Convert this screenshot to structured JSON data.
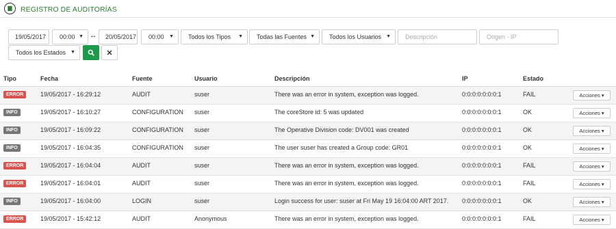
{
  "header": {
    "title": "REGISTRO DE AUDITORÍAS",
    "icon": "book-icon"
  },
  "filters": {
    "date_from": "19/05/2017",
    "time_from": "00:00",
    "date_to": "20/05/2017",
    "time_to": "00:00",
    "separator": "↔",
    "tipo": "Todos los Tipos",
    "fuente": "Todas las Fuentes",
    "usuario": "Todos los Usuarios",
    "descripcion_placeholder": "Descripción",
    "ip_placeholder": "Origen - IP",
    "estado": "Todos los Estados"
  },
  "columns": [
    "Tipo",
    "Fecha",
    "Fuente",
    "Usuario",
    "Descripción",
    "IP",
    "Estado"
  ],
  "action_label": "Acciones",
  "rows": [
    {
      "tipo": "ERROR",
      "fecha": "19/05/2017 - 16:29:12",
      "fuente": "AUDIT",
      "usuario": "suser",
      "descripcion": "There was an error in system, exception was logged.",
      "ip": "0:0:0:0:0:0:0:1",
      "estado": "FAIL"
    },
    {
      "tipo": "INFO",
      "fecha": "19/05/2017 - 16:10:27",
      "fuente": "CONFIGURATION",
      "usuario": "suser",
      "descripcion": "The coreStore id: 5 was updated",
      "ip": "0:0:0:0:0:0:0:1",
      "estado": "OK"
    },
    {
      "tipo": "INFO",
      "fecha": "19/05/2017 - 16:09:22",
      "fuente": "CONFIGURATION",
      "usuario": "suser",
      "descripcion": "The Operative Division code: DV001 was created",
      "ip": "0:0:0:0:0:0:0:1",
      "estado": "OK"
    },
    {
      "tipo": "INFO",
      "fecha": "19/05/2017 - 16:04:35",
      "fuente": "CONFIGURATION",
      "usuario": "suser",
      "descripcion": "The user suser has created a Group code: GR01",
      "ip": "0:0:0:0:0:0:0:1",
      "estado": "OK"
    },
    {
      "tipo": "ERROR",
      "fecha": "19/05/2017 - 16:04:04",
      "fuente": "AUDIT",
      "usuario": "suser",
      "descripcion": "There was an error in system, exception was logged.",
      "ip": "0:0:0:0:0:0:0:1",
      "estado": "FAIL"
    },
    {
      "tipo": "ERROR",
      "fecha": "19/05/2017 - 16:04:01",
      "fuente": "AUDIT",
      "usuario": "suser",
      "descripcion": "There was an error in system, exception was logged.",
      "ip": "0:0:0:0:0:0:0:1",
      "estado": "FAIL"
    },
    {
      "tipo": "INFO",
      "fecha": "19/05/2017 - 16:04:00",
      "fuente": "LOGIN",
      "usuario": "suser",
      "descripcion": "Login success for user: suser at Fri May 19 16:04:00 ART 2017.",
      "ip": "0:0:0:0:0:0:0:1",
      "estado": "OK"
    },
    {
      "tipo": "ERROR",
      "fecha": "19/05/2017 - 15:42:12",
      "fuente": "AUDIT",
      "usuario": "Anonymous",
      "descripcion": "There was an error in system, exception was logged.",
      "ip": "0:0:0:0:0:0:0:1",
      "estado": "FAIL"
    }
  ],
  "colors": {
    "accent": "#2e7d32",
    "search_button": "#1e9a4b",
    "error": "#d9534f",
    "info": "#777777"
  }
}
